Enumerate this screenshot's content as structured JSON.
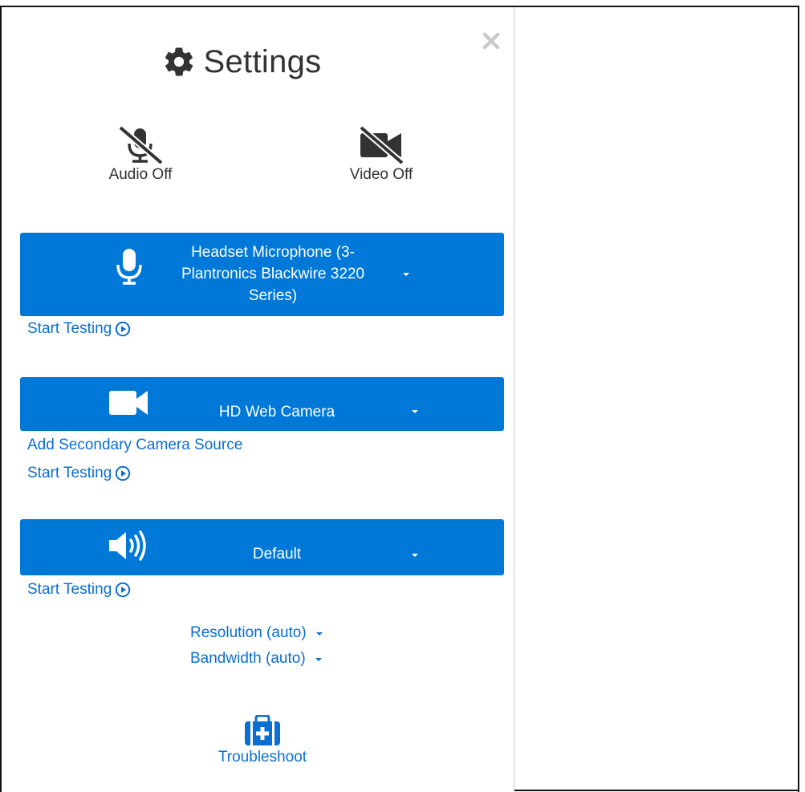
{
  "header": {
    "title": "Settings",
    "icon": "gear-icon"
  },
  "toggles": {
    "audio": {
      "label": "Audio Off",
      "icon": "microphone-off-icon"
    },
    "video": {
      "label": "Video Off",
      "icon": "camera-off-icon"
    }
  },
  "microphone": {
    "selected": "Headset Microphone (3-Plantronics Blackwire 3220 Series)",
    "line1": "Headset Microphone (3-",
    "line2": "Plantronics Blackwire 3220",
    "line3": "Series)",
    "test_label": "Start Testing"
  },
  "camera": {
    "selected": "HD Web Camera",
    "secondary_label": "Add Secondary Camera Source",
    "test_label": "Start Testing"
  },
  "speaker": {
    "selected": "Default",
    "test_label": "Start Testing"
  },
  "options": {
    "resolution": "Resolution (auto)",
    "bandwidth": "Bandwidth (auto)"
  },
  "troubleshoot": {
    "label": "Troubleshoot",
    "icon": "first-aid-kit-icon"
  },
  "colors": {
    "accent": "#0078d7",
    "link": "#0a6fd0",
    "text": "#333333"
  }
}
